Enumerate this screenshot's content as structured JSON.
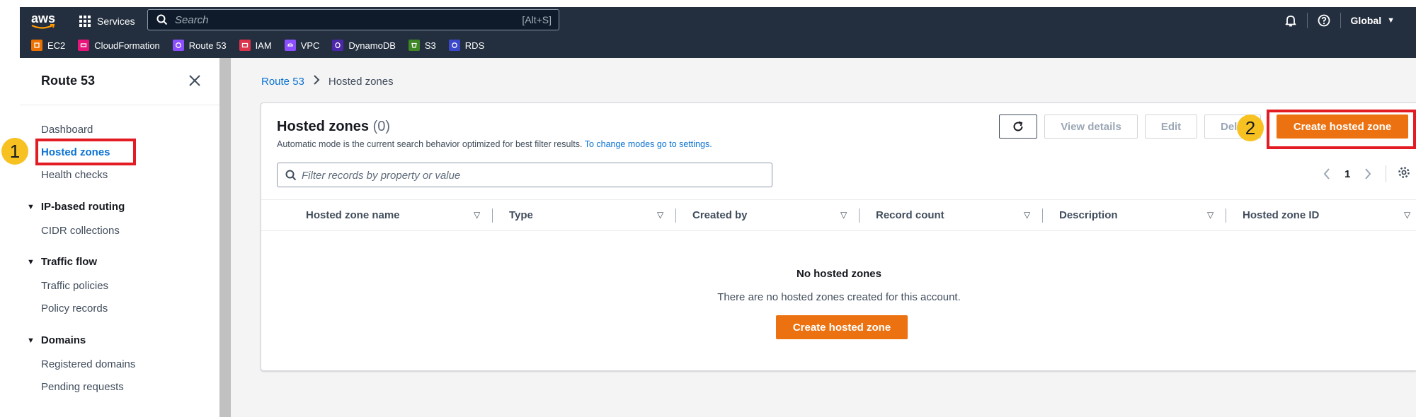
{
  "topnav": {
    "services_label": "Services",
    "search_placeholder": "Search",
    "search_shortcut": "[Alt+S]",
    "region_label": "Global",
    "aws_logo_text": "aws"
  },
  "favorites": [
    {
      "label": "EC2",
      "color": "#ed7100"
    },
    {
      "label": "CloudFormation",
      "color": "#e7157b"
    },
    {
      "label": "Route 53",
      "color": "#8c4fff"
    },
    {
      "label": "IAM",
      "color": "#dd344c"
    },
    {
      "label": "VPC",
      "color": "#8c4fff"
    },
    {
      "label": "DynamoDB",
      "color": "#4d27aa"
    },
    {
      "label": "S3",
      "color": "#3f8624"
    },
    {
      "label": "RDS",
      "color": "#3b48cc"
    }
  ],
  "sidebar": {
    "title": "Route 53",
    "items": {
      "dashboard": "Dashboard",
      "hosted_zones": "Hosted zones",
      "health_checks": "Health checks",
      "ip_routing": "IP-based routing",
      "cidr": "CIDR collections",
      "traffic_flow": "Traffic flow",
      "traffic_policies": "Traffic policies",
      "policy_records": "Policy records",
      "domains": "Domains",
      "registered_domains": "Registered domains",
      "pending_requests": "Pending requests"
    }
  },
  "breadcrumb": {
    "root": "Route 53",
    "current": "Hosted zones"
  },
  "panel": {
    "title": "Hosted zones",
    "count": "(0)",
    "description": "Automatic mode is the current search behavior optimized for best filter results.",
    "description_link": "To change modes go to settings.",
    "buttons": {
      "view_details": "View details",
      "edit": "Edit",
      "delete": "Delete",
      "create": "Create hosted zone"
    },
    "filter_placeholder": "Filter records by property or value",
    "page": "1",
    "columns": [
      "Hosted zone name",
      "Type",
      "Created by",
      "Record count",
      "Description",
      "Hosted zone ID"
    ],
    "empty_title": "No hosted zones",
    "empty_desc": "There are no hosted zones created for this account.",
    "empty_button": "Create hosted zone"
  },
  "annotations": {
    "step1": "1",
    "step2": "2",
    "highlight_color": "#e31b23",
    "badge_color": "#f7c221"
  },
  "colors": {
    "accent_orange": "#ec7211",
    "link_blue": "#0972d3",
    "nav_dark": "#232f3e"
  }
}
